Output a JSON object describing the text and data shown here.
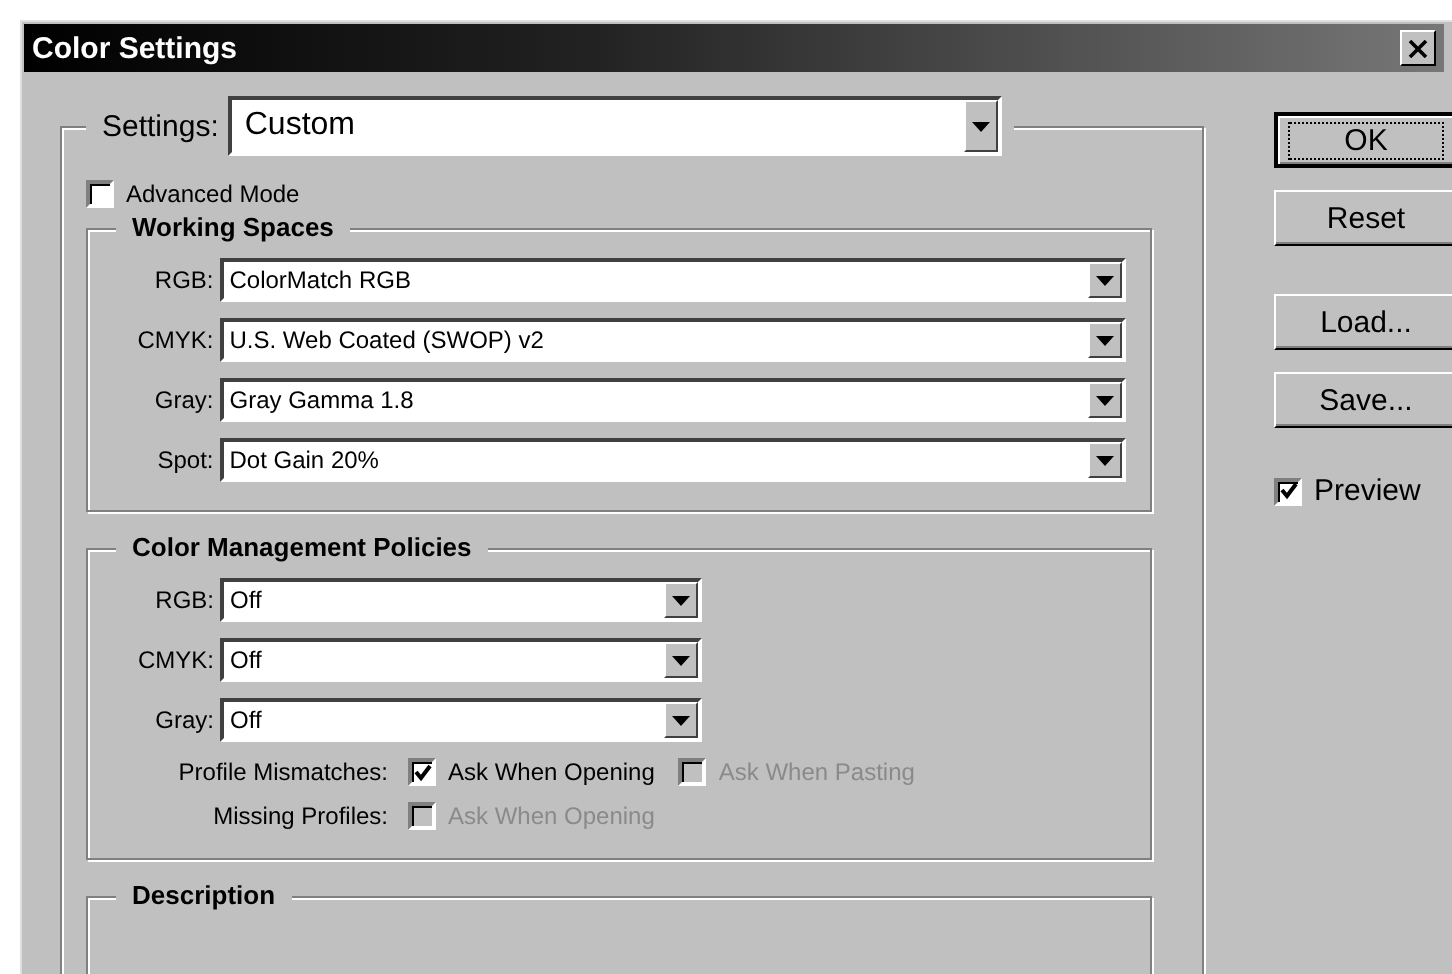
{
  "window": {
    "title": "Color Settings"
  },
  "settings": {
    "label": "Settings:",
    "value": "Custom"
  },
  "advanced_mode": {
    "label": "Advanced Mode",
    "checked": false
  },
  "working_spaces": {
    "title": "Working Spaces",
    "rows": [
      {
        "label": "RGB:",
        "value": "ColorMatch RGB"
      },
      {
        "label": "CMYK:",
        "value": "U.S. Web Coated (SWOP) v2"
      },
      {
        "label": "Gray:",
        "value": "Gray Gamma 1.8"
      },
      {
        "label": "Spot:",
        "value": "Dot Gain 20%"
      }
    ]
  },
  "policies": {
    "title": "Color Management Policies",
    "rows": [
      {
        "label": "RGB:",
        "value": "Off"
      },
      {
        "label": "CMYK:",
        "value": "Off"
      },
      {
        "label": "Gray:",
        "value": "Off"
      }
    ],
    "options": [
      {
        "label": "Profile Mismatches:",
        "checks": [
          {
            "label": "Ask When Opening",
            "checked": true,
            "disabled": false
          },
          {
            "label": "Ask When Pasting",
            "checked": false,
            "disabled": true
          }
        ]
      },
      {
        "label": "Missing Profiles:",
        "checks": [
          {
            "label": "Ask When Opening",
            "checked": false,
            "disabled": true
          }
        ]
      }
    ]
  },
  "description": {
    "title": "Description"
  },
  "buttons": [
    {
      "label": "OK",
      "focused": true
    },
    {
      "label": "Reset",
      "focused": false
    },
    {
      "label": "Load...",
      "focused": false
    },
    {
      "label": "Save...",
      "focused": false
    }
  ],
  "preview": {
    "label": "Preview",
    "checked": true
  }
}
